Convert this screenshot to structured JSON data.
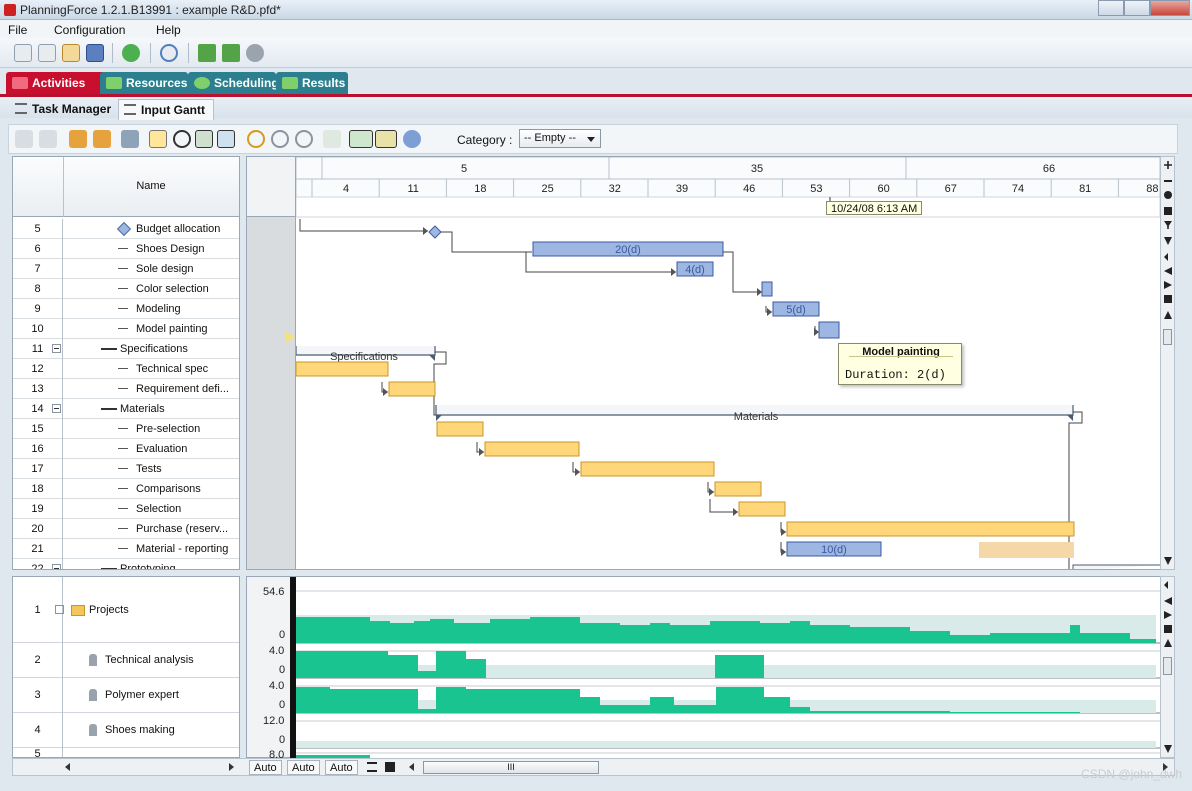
{
  "window": {
    "title": "PlanningForce 1.2.1.B13991 : example R&D.pfd*"
  },
  "menu": [
    "File",
    "Configuration",
    "Help"
  ],
  "main_tabs": [
    {
      "label": "Activities",
      "color": "#c8102e",
      "active": true
    },
    {
      "label": "Resources",
      "color": "#2b7f8f",
      "active": false
    },
    {
      "label": "Scheduling",
      "color": "#2b7f8f",
      "active": false
    },
    {
      "label": "Results",
      "color": "#2b7f8f",
      "active": false
    }
  ],
  "sub_tabs": [
    {
      "label": "Task Manager",
      "active": false
    },
    {
      "label": "Input Gantt",
      "active": true
    }
  ],
  "filter": {
    "label": "Category :",
    "value": "-- Empty --"
  },
  "task_grid": {
    "header": "Name",
    "rows": [
      {
        "num": "5",
        "name": "Budget allocation",
        "kind": "milestone"
      },
      {
        "num": "6",
        "name": "Shoes Design",
        "kind": "task"
      },
      {
        "num": "7",
        "name": "Sole design",
        "kind": "task"
      },
      {
        "num": "8",
        "name": "Color selection",
        "kind": "task"
      },
      {
        "num": "9",
        "name": "Modeling",
        "kind": "task"
      },
      {
        "num": "10",
        "name": "Model painting",
        "kind": "task"
      },
      {
        "num": "11",
        "name": "Specifications",
        "kind": "summary"
      },
      {
        "num": "12",
        "name": "Technical spec",
        "kind": "task"
      },
      {
        "num": "13",
        "name": "Requirement defi...",
        "kind": "task"
      },
      {
        "num": "14",
        "name": "Materials",
        "kind": "summary"
      },
      {
        "num": "15",
        "name": "Pre-selection",
        "kind": "task"
      },
      {
        "num": "16",
        "name": "Evaluation",
        "kind": "task"
      },
      {
        "num": "17",
        "name": "Tests",
        "kind": "task"
      },
      {
        "num": "18",
        "name": "Comparisons",
        "kind": "task"
      },
      {
        "num": "19",
        "name": "Selection",
        "kind": "task"
      },
      {
        "num": "20",
        "name": "Purchase (reserv...",
        "kind": "task"
      },
      {
        "num": "21",
        "name": "Material - reporting",
        "kind": "task"
      },
      {
        "num": "22",
        "name": "Prototyping",
        "kind": "summary"
      }
    ]
  },
  "timeline": {
    "top": [
      "5",
      "35",
      "66"
    ],
    "bottom": [
      "4",
      "11",
      "18",
      "25",
      "32",
      "39",
      "46",
      "53",
      "60",
      "67",
      "74",
      "81",
      "88"
    ],
    "cursor_label": "10/24/08 6:13 AM"
  },
  "gantt": {
    "bar_labels": {
      "shoes_design": "20(d)",
      "sole_design": "4(d)",
      "modeling": "5(d)",
      "material_reporting": "10(d)"
    },
    "summary_labels": {
      "specifications": "Specifications",
      "materials": "Materials"
    }
  },
  "tooltip": {
    "title": "Model painting",
    "body": "Duration: 2(d)"
  },
  "resource_grid": {
    "rows": [
      {
        "num": "1",
        "name": "Projects",
        "max": "54.6",
        "min": "0"
      },
      {
        "num": "2",
        "name": "Technical analysis",
        "max": "4.0",
        "min": "0"
      },
      {
        "num": "3",
        "name": "Polymer expert",
        "max": "4.0",
        "min": "0"
      },
      {
        "num": "4",
        "name": "Shoes making",
        "max": "12.0",
        "min": "0"
      },
      {
        "num": "5",
        "name": "",
        "max": "8.0",
        "min": ""
      }
    ]
  },
  "bottom": {
    "auto_buttons": [
      "Auto",
      "Auto",
      "Auto"
    ],
    "scroll_mid": "III"
  },
  "watermark": "CSDN @john_dwh",
  "colors": {
    "blue_bar": "#9db6e2",
    "blue_border": "#3b5aa0",
    "orange_bar": "#ffd77a",
    "orange_border": "#c9962a",
    "green_load": "#19c491",
    "load_bg": "#d8ebe9",
    "accent_red": "#c8102e"
  }
}
